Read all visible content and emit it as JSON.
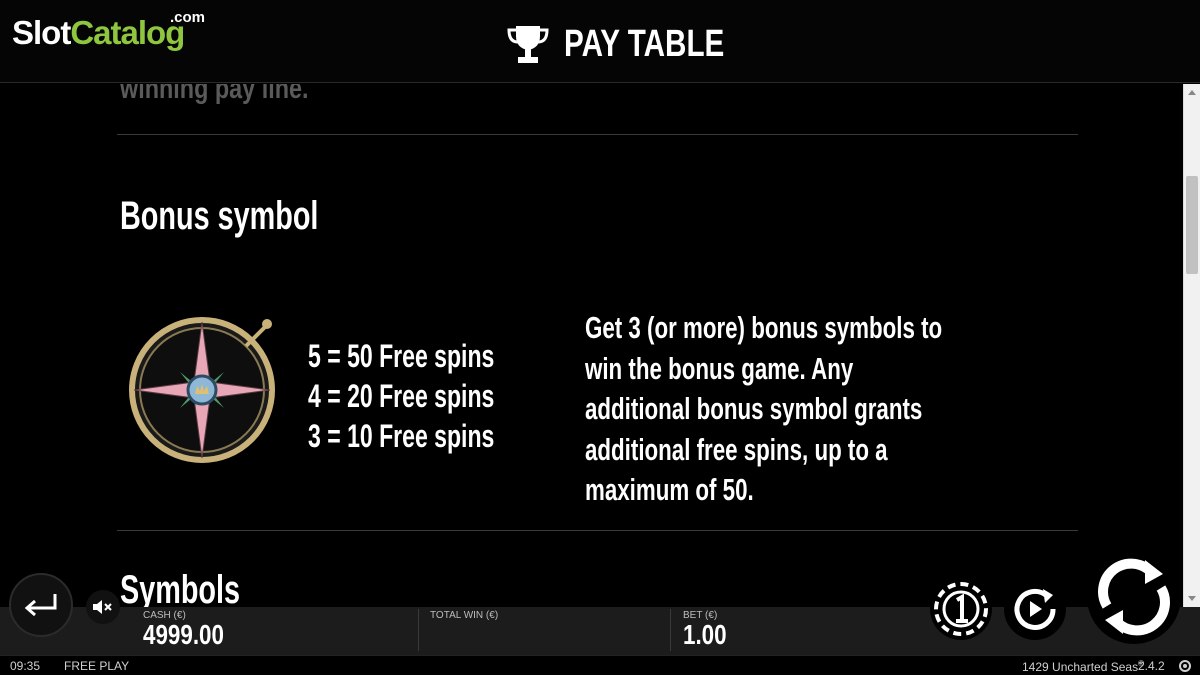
{
  "brand": {
    "slot": "Slot",
    "catalog": "Catalog",
    "com": ".com"
  },
  "header": {
    "title": "PAY TABLE",
    "title_icon": "trophy-icon"
  },
  "content": {
    "faded_line": "winning pay line.",
    "bonus": {
      "title": "Bonus symbol",
      "symbol_icon": "compass-rose-icon",
      "payouts": [
        "5 = 50 Free spins",
        "4 = 20 Free spins",
        "3 = 10 Free spins"
      ],
      "description_lines": [
        "Get 3 (or more) bonus symbols to",
        "win the bonus game. Any",
        "additional bonus symbol grants",
        "additional free spins, up to a",
        "maximum of 50."
      ]
    },
    "next_section_title": "Symbols"
  },
  "bottom_bar": {
    "cash_label": "CASH (€)",
    "cash_value": "4999.00",
    "total_win_label": "TOTAL WIN (€)",
    "bet_label": "BET (€)",
    "bet_value": "1.00"
  },
  "status_bar": {
    "time": "09:35",
    "mode": "FREE PLAY",
    "game_name": "1429 Uncharted Seas",
    "trademark": "®",
    "version": "2.4.2"
  },
  "controls": {
    "back": "back-arrow-icon",
    "mute": "speaker-muted-icon",
    "bet": "coin-bet-icon",
    "autoplay": "autoplay-icon",
    "spin": "spin-icon"
  },
  "colors": {
    "brand_green": "#8ec63f",
    "background": "#000000",
    "bar": "#1c1c1c"
  }
}
